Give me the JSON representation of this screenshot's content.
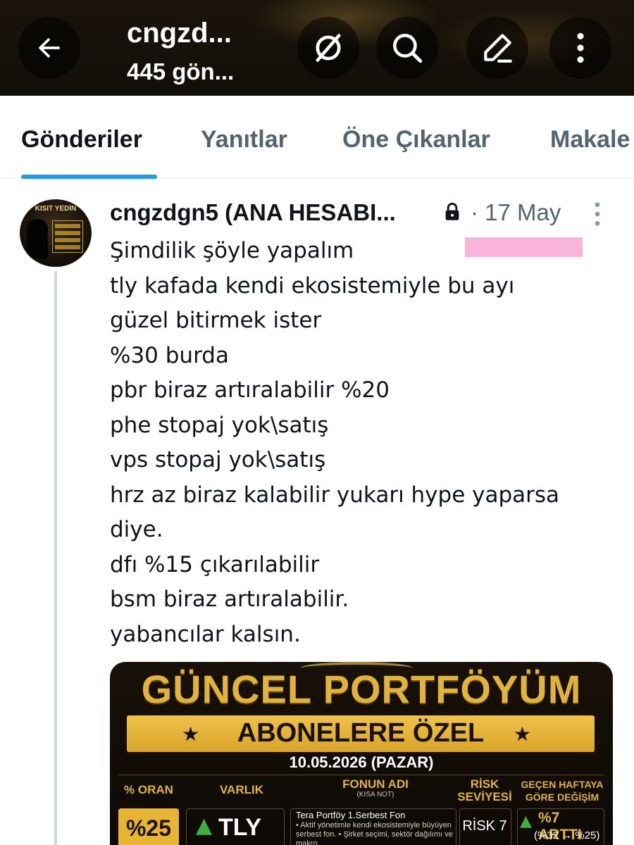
{
  "header": {
    "title": "cngzd...",
    "subtitle": "445 gön...",
    "icons": [
      "back-arrow-icon",
      "no-sign-icon",
      "search-icon",
      "edit-icon",
      "more-vertical-icon"
    ]
  },
  "tabs": [
    {
      "label": "Gönderiler",
      "active": true
    },
    {
      "label": "Yanıtlar",
      "active": false
    },
    {
      "label": "Öne Çıkanlar",
      "active": false
    },
    {
      "label": "Makale",
      "active": false
    }
  ],
  "post": {
    "author": "cngzdgn5 (ANA HESABI...",
    "date": "· 17 May",
    "avatar": {
      "text": "KISIT YEDİN"
    },
    "lines": [
      "Şimdilik şöyle yapalım",
      "tly kafada kendi ekosistemiyle bu ayı",
      "güzel bitirmek ister",
      "%30 burda",
      "pbr biraz artıralabilir %20",
      "phe stopaj yok\\satış",
      "vps stopaj yok\\satış",
      "hrz az biraz kalabilir yukarı hype yaparsa",
      "diye.",
      "dfı %15 çıkarılabilir",
      "bsm biraz artıralabilir.",
      "yabancılar kalsın."
    ]
  },
  "media": {
    "title": "GÜNCEL PORTFÖYÜM",
    "banner": "ABONELERE ÖZEL",
    "star": "★",
    "date": "10.05.2026 (PAZAR)",
    "columns": {
      "pct": "% ORAN",
      "asset": "VARLIK",
      "fund": "FONUN ADI",
      "fund_note": "(KISA NOT)",
      "risk": "RİSK",
      "risk2": "SEVİYESİ",
      "change": "GEÇEN HAFTAYA",
      "change2": "GÖRE DEĞİŞİM"
    },
    "row": {
      "pct": "%25",
      "ticker": "TLY",
      "fund_name": "Tera Portföy 1.Serbest Fon",
      "fund_desc": "• Aktif yönetimle kendi ekosistemiyle büyüyen serbest fon. • Şirket seçimi, sektör dağılımı ve makro",
      "risk": "RİSK 7",
      "change": "%7 ARTTI",
      "change_sub": "(%32 → %25)"
    },
    "colors": {
      "gold": "#e2b33c",
      "up": "#3fae3a"
    }
  },
  "colors": {
    "accent": "#1d9bf0",
    "text": "#0f1419",
    "muted": "#536471"
  }
}
